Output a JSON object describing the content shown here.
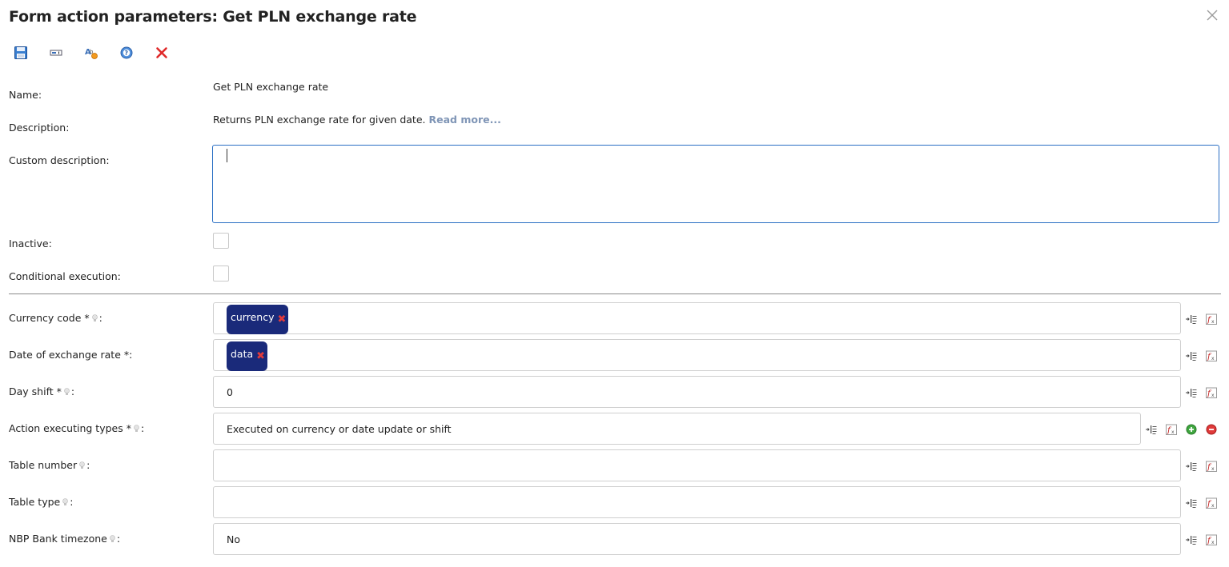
{
  "dialog": {
    "title": "Form action parameters: Get PLN exchange rate"
  },
  "toolbar": {
    "buttons": [
      {
        "name": "save",
        "icon": "floppy-disk-icon"
      },
      {
        "name": "input-field",
        "icon": "input-field-icon"
      },
      {
        "name": "translate",
        "icon": "translate-icon"
      },
      {
        "name": "help",
        "icon": "help-icon"
      },
      {
        "name": "cancel",
        "icon": "red-x-icon"
      }
    ]
  },
  "general": {
    "name_label": "Name:",
    "name_value": "Get PLN exchange rate",
    "description_label": "Description:",
    "description_value": "Returns PLN exchange rate for given date.",
    "read_more": "Read more...",
    "custom_description_label": "Custom description:",
    "custom_description_value": "",
    "inactive_label": "Inactive:",
    "inactive_checked": false,
    "conditional_label": "Conditional execution:",
    "conditional_checked": false
  },
  "params": {
    "currency_code": {
      "label": "Currency code *",
      "tag": "currency"
    },
    "date_of_rate": {
      "label": "Date of exchange rate *:",
      "tag": "data"
    },
    "day_shift": {
      "label": "Day shift *",
      "value": "0"
    },
    "executing_types": {
      "label": "Action executing types *",
      "value": "Executed on currency or date update or shift"
    },
    "table_number": {
      "label": "Table number",
      "value": ""
    },
    "table_type": {
      "label": "Table type",
      "value": ""
    },
    "nbp_timezone": {
      "label": "NBP Bank timezone",
      "value": "No"
    }
  },
  "colors": {
    "accent": "#2a6fc4",
    "tag_bg": "#1a2a7a",
    "tag_remove": "#e23b3b",
    "link": "#7f95b6"
  }
}
